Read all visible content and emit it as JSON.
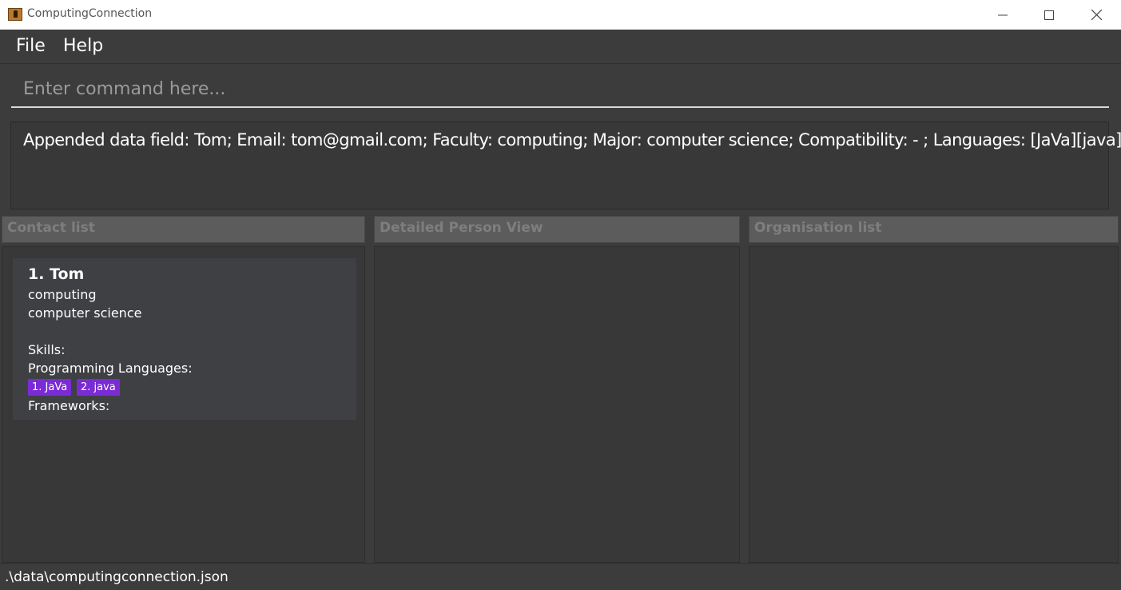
{
  "window": {
    "title": "ComputingConnection",
    "app_icon": "contact-book-icon",
    "controls": [
      "minimize-icon",
      "maximize-icon",
      "close-icon"
    ]
  },
  "menu": {
    "items": [
      {
        "label": "File"
      },
      {
        "label": "Help"
      }
    ]
  },
  "command": {
    "placeholder": "Enter command here..."
  },
  "result": {
    "text": "Appended data field: Tom; Email: tom@gmail.com; Faculty: computing; Major: computer science; Compatibility:  - ; Languages: [JaVa][java]"
  },
  "panels": {
    "contacts_header": "Contact list",
    "detail_header": "Detailed Person View",
    "orgs_header": "Organisation list"
  },
  "contacts": [
    {
      "index_name": "1.  Tom",
      "faculty": "computing",
      "major": "computer science",
      "skills_label": "Skills:",
      "languages_label": "Programming Languages:",
      "languages": [
        "1. JaVa",
        "2. java"
      ],
      "frameworks_label": "Frameworks:"
    }
  ],
  "status": {
    "file_path": ".\\data\\computingconnection.json"
  },
  "colors": {
    "background": "#3c3c3c",
    "tag": "#7b2bd4",
    "header": "#5c5c5c"
  }
}
